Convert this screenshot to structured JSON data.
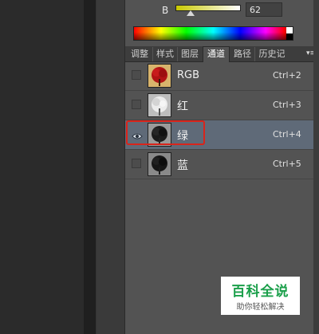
{
  "color_slider": {
    "label": "B",
    "value": "62",
    "level_percent": 24
  },
  "tabs": [
    {
      "label": "调整",
      "active": false
    },
    {
      "label": "样式",
      "active": false
    },
    {
      "label": "图层",
      "active": false
    },
    {
      "label": "通道",
      "active": true
    },
    {
      "label": "路径",
      "active": false
    },
    {
      "label": "历史记",
      "active": false
    }
  ],
  "channels": [
    {
      "name": "RGB",
      "shortcut": "Ctrl+2",
      "visible": false,
      "selected": false
    },
    {
      "name": "红",
      "shortcut": "Ctrl+3",
      "visible": false,
      "selected": false
    },
    {
      "name": "绿",
      "shortcut": "Ctrl+4",
      "visible": true,
      "selected": true
    },
    {
      "name": "蓝",
      "shortcut": "Ctrl+5",
      "visible": false,
      "selected": false
    }
  ],
  "watermark": {
    "title": "百科全说",
    "subtitle": "助你轻松解决"
  },
  "colors": {
    "panel": "#535353",
    "selected_row": "#5f6a78",
    "highlight_box": "#d9241b",
    "watermark_green": "#1a9f4a"
  }
}
